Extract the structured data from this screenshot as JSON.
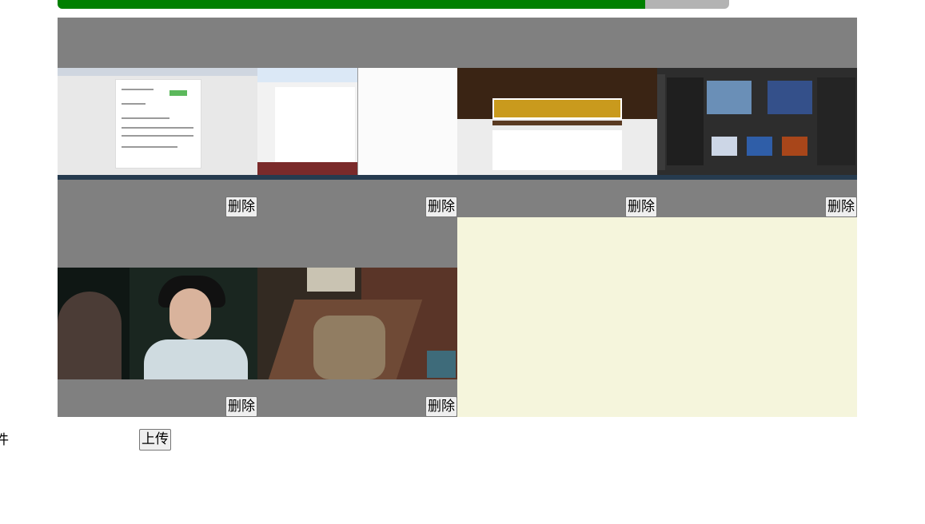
{
  "upload_progress": {
    "percent": 87.5
  },
  "gallery": {
    "items": [
      {
        "thumbnail": "invoice-document-screenshot",
        "delete_label": "删除"
      },
      {
        "thumbnail": "file-explorer-screenshot",
        "delete_label": "删除"
      },
      {
        "thumbnail": "shopping-cart-screenshot",
        "delete_label": "删除"
      },
      {
        "thumbnail": "image-editor-screenshot",
        "delete_label": "删除"
      },
      {
        "thumbnail": "drama-still-photo",
        "delete_label": "删除"
      },
      {
        "thumbnail": "cinema-game-screenshot",
        "delete_label": "删除"
      }
    ]
  },
  "footer": {
    "file_label": "件",
    "upload_label": "上传"
  },
  "colors": {
    "progress_fill": "#008000",
    "progress_track": "#b3b3b3",
    "card_bg": "#808080",
    "gallery_bg": "#f5f5dc"
  }
}
